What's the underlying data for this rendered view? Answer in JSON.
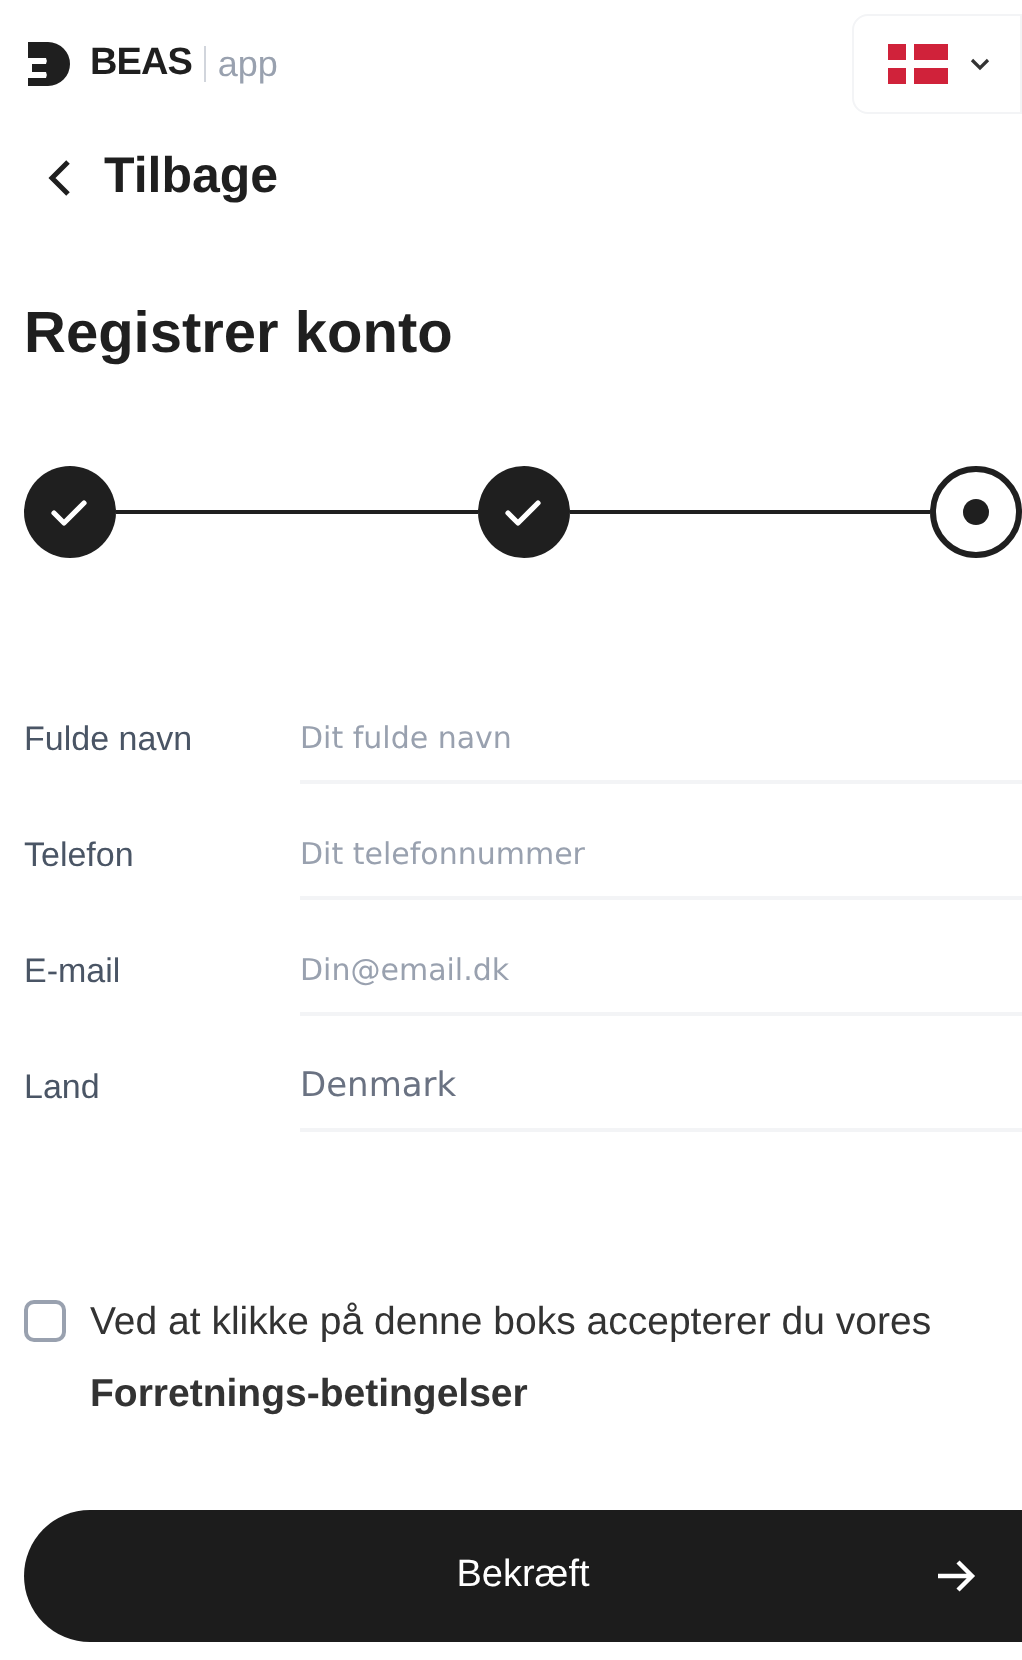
{
  "header": {
    "brand": "BEAS",
    "brand_suffix": "app"
  },
  "back": {
    "label": "Tilbage"
  },
  "title": "Registrer konto",
  "steps": [
    {
      "kind": "done"
    },
    {
      "kind": "done"
    },
    {
      "kind": "current"
    }
  ],
  "fields": [
    {
      "label": "Fulde navn",
      "placeholder": "Dit fulde navn"
    },
    {
      "label": "Telefon",
      "placeholder": "Dit telefonnummer"
    },
    {
      "label": "E-mail",
      "placeholder": "Din@email.dk"
    },
    {
      "label": "Land",
      "value": "Denmark"
    }
  ],
  "terms": {
    "checked": false,
    "text": "Ved at klikke på denne boks accepterer du vores **Forretnings-betingelser**"
  },
  "submit": {
    "label": "Bekræft"
  }
}
